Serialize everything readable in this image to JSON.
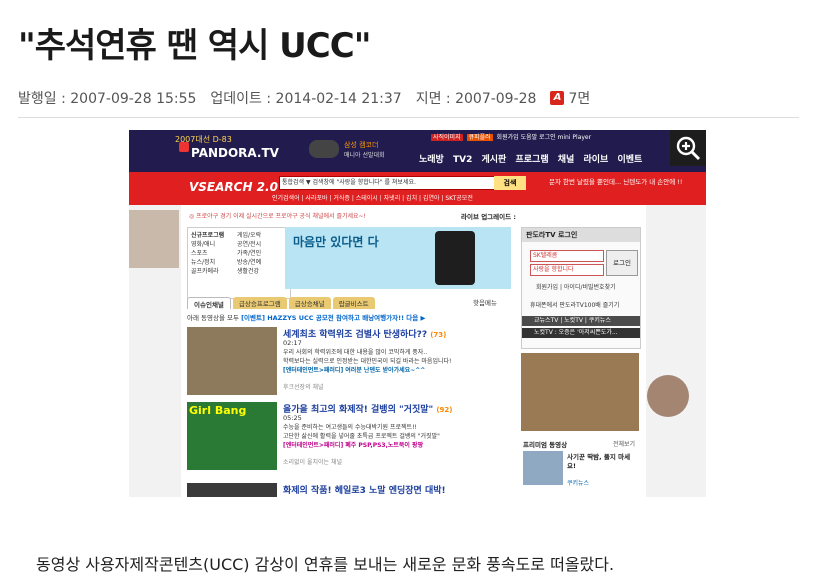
{
  "article": {
    "title": "\"추석연휴 땐 역시 UCC\"",
    "published": "발행일 : 2007-09-28 15:55",
    "updated": "업데이트 : 2014-02-14 21:37",
    "paper_date": "지면 : 2007-09-28",
    "pdf_icon": "pdf-icon",
    "page": "7면",
    "lead": "동영상 사용자제작콘텐츠(UCC) 감상이 연휴를 보내는 새로운 문화 풍속도로 떠올랐다."
  },
  "screenshot": {
    "zoom_icon": "magnify-plus-icon",
    "campaign": "2007대선 D-83",
    "logo": "PANDORA.TV",
    "cam_title": "삼성 캠코더",
    "cam_sub": "매니아 선발대회",
    "top_links": [
      "사직이미지",
      "큐피플러",
      "회원가입",
      "도움말",
      "로그인",
      "mini Player"
    ],
    "nav": [
      "노래방",
      "TV2",
      "게시판",
      "프로그램",
      "채널",
      "라이브",
      "이벤트"
    ],
    "vsearch": "VSEARCH 2.0",
    "search_input": "통합검색 ▼ 검색창에 \"사랑을 향합니다\" 를 쳐보세요.",
    "search_button": "검색",
    "search_keywords": "인기검색어 | 사라포바 | 거식증 | 스테이시 | 자넷리 | 김치 | 김연아 | SKT공모전",
    "ad_text": "문자 한번 날렸을 뿐인데... 닌텐도가 내 손안에 !!",
    "ticker": "◎ 프로야구 경기 이제 실시간으로 프로야구 공식 채널에서 즐기세요~!",
    "live_update": "라이브 업그레이드 :",
    "categories": [
      "신규프로그램",
      "게임/오락",
      "영화/애니",
      "공연/전시",
      "스포츠",
      "가족/연인",
      "뉴스/정치",
      "방송/연예",
      "골프카메라",
      "생활건강"
    ],
    "banner_text": "마음만 있다면 다",
    "tabs": [
      "이슈인채널",
      "급상승프로그램",
      "급상승채널",
      "랍글비스트"
    ],
    "tab_hot": "핫음메뉴",
    "notice_prefix": "아래 동영상을 모두",
    "notice": "[이벤트] HAZZYS UCC 공모전 참여하고 배낭여행가자!! 다음 ▶",
    "items": [
      {
        "title": "세계최초 학력위조 검별사 탄생하다??",
        "count": "(73)",
        "time": "02:17",
        "desc1": "우리 사회의 학력위조에 대한 내용을 많이 코믹하게 풍자..",
        "desc2": "학력보다는 실력으로 인정받는 대한민국이 되길 바라는 마음입니다!",
        "tag": "[엔터테인먼트>패러디] 여러분 난덴도 받아가세요~^^",
        "link": "후크선장의 채널",
        "thumb_caption": ""
      },
      {
        "title": "올가을 최고의 화제작! 걸뱅의 \"거짓말\"",
        "count": "(92)",
        "time": "05:25",
        "desc1": "수능을 준비하는 여고생들의 수능대박기원 프로젝트!!",
        "desc2": "고단한 삶신에 활력을 넣어줄 초특급 프로젝트 걸뱅의 \"거짓말\"",
        "tag": "[엔터테인먼트>패러디] 폐주 PSP,PS3,노트북이 팡팡",
        "link": "소리없이 울치이는 채널",
        "thumb_caption": "Girl Bang"
      },
      {
        "title": "화제의 작품! 헤일로3 노말 엔딩장면 대박!",
        "count": "",
        "time": "",
        "desc1": "",
        "desc2": "",
        "tag": "",
        "link": "",
        "thumb_caption": ""
      }
    ],
    "login": {
      "header": "판도라TV 로그인",
      "id_placeholder": "SK텔레콤",
      "pw_placeholder": "사랑을 향합니다",
      "button": "로그인",
      "links": "회원가입 | 아이디/비밀번호찾기",
      "line1": "휴대폰에서 판도라TV100배 즐기기",
      "strip1": "교뉴스TV | 노컷TV | 쿠키뉴스",
      "strip2": "노컷TV : 오증은 '아저씨쁜도가..."
    },
    "premium": {
      "header": "프리미엄 동영상",
      "all": "전체보기",
      "title": "사기꾼 딱밤, 풀지 마세요!",
      "source": "쿠키뉴스"
    }
  }
}
